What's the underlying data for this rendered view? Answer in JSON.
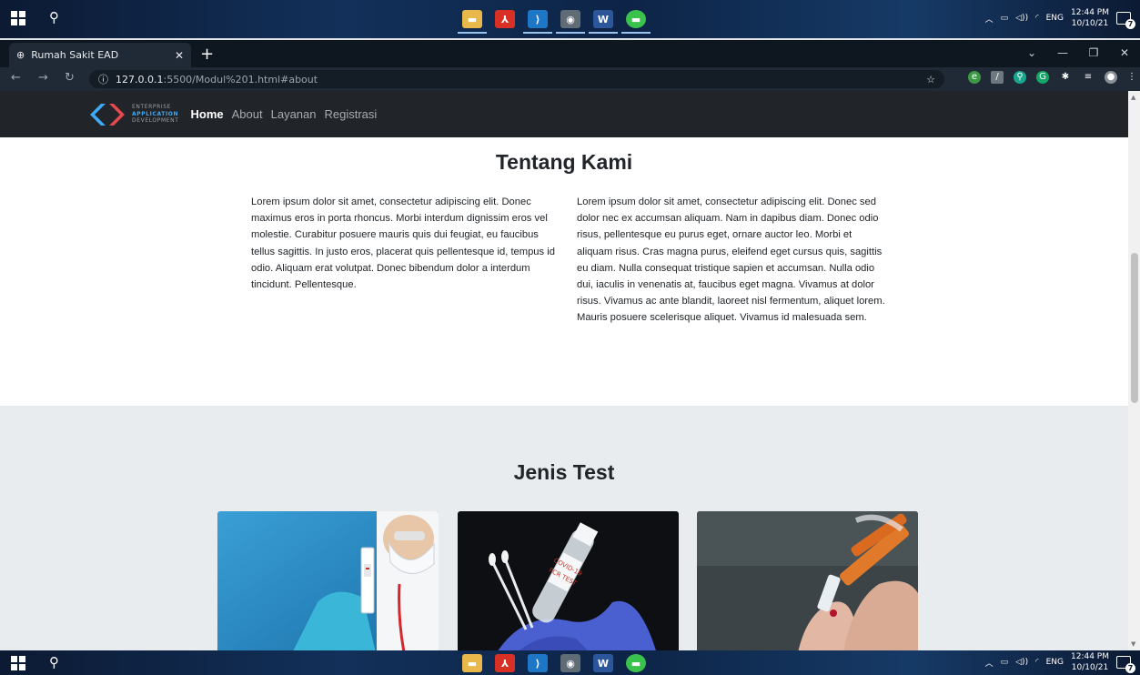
{
  "os": {
    "taskbar_icons": [
      "file-explorer-icon",
      "pdf-reader-icon",
      "vscode-icon",
      "chrome-icon",
      "word-icon",
      "line-icon"
    ],
    "tray": {
      "language": "ENG",
      "time": "12:44 PM",
      "date": "10/10/21",
      "notifications": "7"
    }
  },
  "browser": {
    "tab_title": "Rumah Sakit EAD",
    "new_tab": "+",
    "url_host": "127.0.0.1",
    "url_rest": ":5500/Modul%201.html#about"
  },
  "site": {
    "logo": {
      "line1": "ENTERPRISE",
      "line2": "APPLICATION",
      "line3": "DEVELOPMENT"
    },
    "nav": [
      "Home",
      "About",
      "Layanan",
      "Registrasi"
    ],
    "about_title": "Tentang Kami",
    "about_col1": "Lorem ipsum dolor sit amet, consectetur adipiscing elit. Donec maximus eros in porta rhoncus. Morbi interdum dignissim eros vel molestie. Curabitur posuere mauris quis dui feugiat, eu faucibus tellus sagittis. In justo eros, placerat quis pellentesque id, tempus id odio. Aliquam erat volutpat. Donec bibendum dolor a interdum tincidunt. Pellentesque.",
    "about_col2": "Lorem ipsum dolor sit amet, consectetur adipiscing elit. Donec sed dolor nec ex accumsan aliquam. Nam in dapibus diam. Donec odio risus, pellentesque eu purus eget, ornare auctor leo. Morbi et aliquam risus. Cras magna purus, eleifend eget cursus quis, sagittis eu diam. Nulla consequat tristique sapien et accumsan. Nulla odio dui, iaculis in venenatis at, faucibus eget magna. Vivamus at dolor risus. Vivamus ac ante blandit, laoreet nisl fermentum, aliquet lorem. Mauris posuere scelerisque aliquet. Vivamus id malesuada sem.",
    "tests_title": "Jenis Test",
    "card_images": [
      "antigen-test-photo",
      "pcr-test-photo",
      "blood-test-photo"
    ],
    "card_labels": [
      "COVID-19",
      "PCR TEST"
    ]
  },
  "colors": {
    "navbar": "#212529",
    "accent": "#3fa9f5",
    "section_bg": "#e9ecef"
  }
}
